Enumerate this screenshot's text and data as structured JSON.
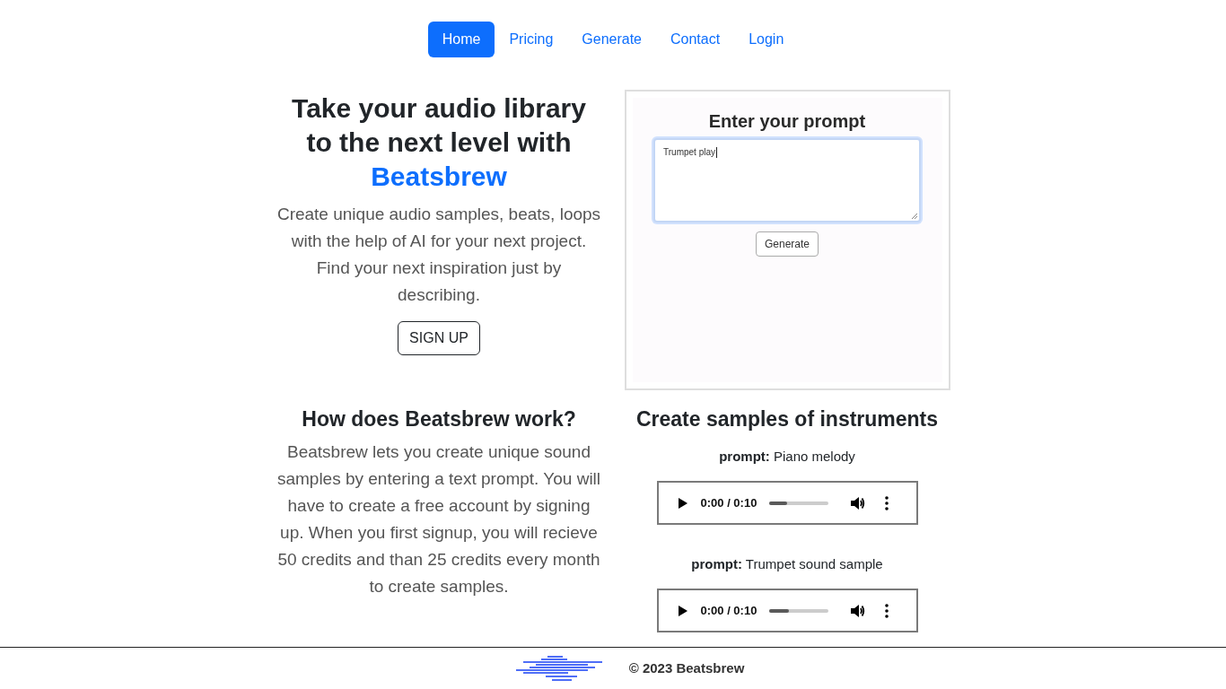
{
  "nav": [
    {
      "label": "Home",
      "selected": true
    },
    {
      "label": "Pricing",
      "selected": false
    },
    {
      "label": "Generate",
      "selected": false
    },
    {
      "label": "Contact",
      "selected": false
    },
    {
      "label": "Login",
      "selected": false
    }
  ],
  "hero": {
    "heading": "Take your audio library to the next level with",
    "heading_highlight": "Beatsbrew",
    "text": "Create unique audio samples, beats, loops with the help of AI for your next project. Find your next inspiration just by describing.",
    "button": "SIGN UP"
  },
  "prompt_panel": {
    "title": "Enter your prompt",
    "value": "Trumpet play",
    "focused": true,
    "button": "Generate"
  },
  "how_it_works": {
    "title": "How does Beatsbrew work?",
    "text": "Beatsbrew lets you create unique sound samples by entering a text prompt. You will have to create a free account by signing up. When you first signup, you will recieve 50 credits and than 25 credits every month to create samples."
  },
  "samples": {
    "title": "Create samples of instruments",
    "items": [
      {
        "prompt": "**prompt:** Piano melody",
        "time": "0:00 / 0:10",
        "level": 0.29
      },
      {
        "prompt": "**prompt:** Trumpet sound sample",
        "time": "0:00 / 0:10",
        "level": 0.33
      }
    ]
  },
  "footer": {
    "copyright": "© 2023 Beatsbrew"
  }
}
